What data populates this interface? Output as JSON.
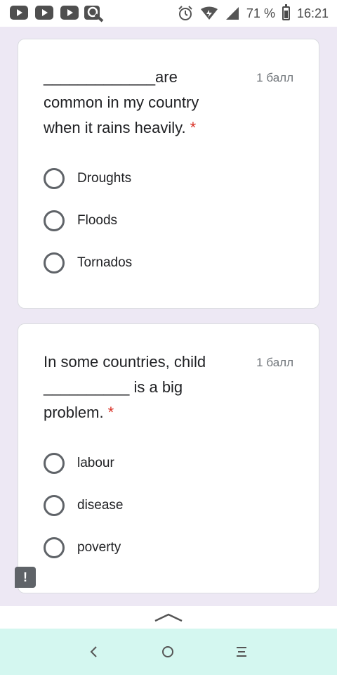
{
  "status_bar": {
    "battery_percent": "71 %",
    "time": "16:21",
    "icons": [
      "youtube-icon",
      "youtube-icon",
      "youtube-icon",
      "search-icon",
      "alarm-icon",
      "data-saver-icon",
      "signal-icon",
      "battery-icon"
    ]
  },
  "questions": [
    {
      "title": "_____________are common in my country when it rains heavily.",
      "required_mark": "*",
      "points": "1 балл",
      "options": [
        "Droughts",
        "Floods",
        "Tornados"
      ]
    },
    {
      "title": "In some countries, child __________ is a big problem.",
      "required_mark": "*",
      "points": "1 балл",
      "options": [
        "labour",
        "disease",
        "poverty"
      ]
    }
  ],
  "feedback_icon": "!",
  "colors": {
    "page_background": "#ede8f4",
    "required": "#d93025",
    "nav_bar": "#d4f7f0"
  }
}
